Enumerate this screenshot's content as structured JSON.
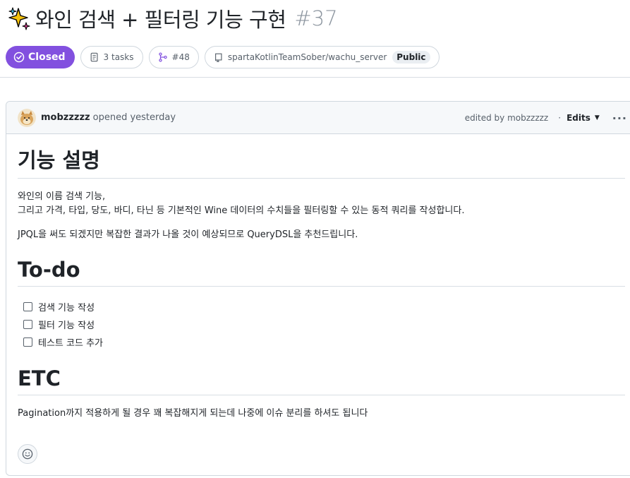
{
  "issue": {
    "emoji": "sparkles",
    "title": "와인 검색 + 필터링 기능 구현",
    "number": "#37",
    "state": "Closed",
    "tasks": "3 tasks",
    "linked_pr": "#48",
    "repo": "spartaKotlinTeamSober/wachu_server",
    "visibility": "Public"
  },
  "comment": {
    "author": "mobzzzzz",
    "action": "opened yesterday",
    "edited_by": "edited by mobzzzzz",
    "separator": "·",
    "edits_label": "Edits",
    "more_label": "···",
    "sections": [
      {
        "heading": "기능 설명",
        "paragraphs": [
          "와인의 이름 검색 기능,",
          "그리고 가격, 타입, 당도, 바디, 타닌 등 기본적인 Wine 데이터의 수치들을 필터링할 수 있는 동적 쿼리를 작성합니다.",
          "JPQL을 써도 되겠지만 복잡한 결과가 나올 것이 예상되므로 QueryDSL을 추천드립니다."
        ]
      },
      {
        "heading": "To-do",
        "tasks": [
          "검색 기능 작성",
          "필터 기능 작성",
          "테스트 코드 추가"
        ]
      },
      {
        "heading": "ETC",
        "paragraphs": [
          "Pagination까지 적용하게 될 경우 꽤 복잡해지게 되는데 나중에 이슈 분리를 하셔도 됩니다"
        ]
      }
    ]
  },
  "icons": {
    "state": "issue-closed-icon",
    "tasks": "checklist-icon",
    "pr": "git-pull-request-icon",
    "repo": "repo-icon",
    "reaction": "smiley-icon"
  },
  "colors": {
    "closed_purple": "#8250df",
    "muted_text": "#57606a",
    "border": "#d0d7de"
  }
}
